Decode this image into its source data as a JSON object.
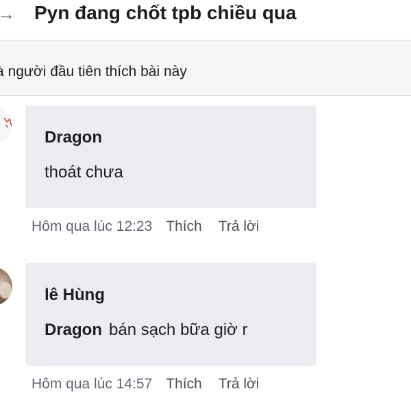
{
  "header": {
    "title": "Pyn đang chốt tpb chiều qua",
    "back_icon": "arrow-right-icon"
  },
  "likes_bar": {
    "text": "à người đầu tiên thích bài này"
  },
  "comments": [
    {
      "author": "Dragon",
      "text": "thoát chưa",
      "time": "Hôm qua lúc 12:23",
      "like_label": "Thích",
      "reply_label": "Trả lời"
    },
    {
      "author": "lê Hùng",
      "mention": "Dragon",
      "text": "bán sạch bữa giờ r",
      "time": "Hôm qua lúc 14:57",
      "like_label": "Thích",
      "reply_label": "Trả lời"
    }
  ],
  "colors": {
    "bubble_bg": "#ebedf0",
    "meta_time": "#606770",
    "meta_action": "#4b4f56",
    "likes_bar_bg": "#f5f6f7"
  }
}
